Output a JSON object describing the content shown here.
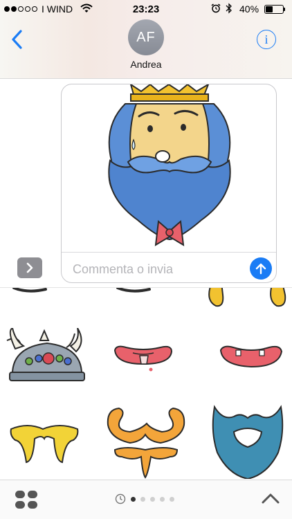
{
  "status_bar": {
    "signal": "●●○○○",
    "carrier": "I WIND",
    "time": "23:23",
    "battery_percent": "40%",
    "battery_level": 0.4,
    "icons": [
      "wifi-icon",
      "alarm-icon",
      "bluetooth-icon",
      "battery-icon"
    ]
  },
  "header": {
    "avatar_initials": "AF",
    "contact_name": "Andrea",
    "back_icon": "chevron-left-icon",
    "info_label": "i"
  },
  "compose": {
    "placeholder": "Commenta o invia",
    "value": "",
    "send_icon": "arrow-up-icon",
    "attached_sticker": "bearded-king-face-sticker"
  },
  "stickers": [
    "eyebrows-sticker",
    "golden-ears-sticker",
    "viking-helmet-sticker",
    "tongue-mouth-sticker",
    "open-mouth-sticker",
    "yellow-mustache-sticker",
    "orange-mustache-goatee-sticker",
    "blue-beard-sticker"
  ],
  "bottom_bar": {
    "pages": 5,
    "active_page": 1,
    "icons": [
      "app-drawer-icon",
      "recent-clock-icon",
      "chevron-up-icon"
    ]
  },
  "colors": {
    "accent": "#1a7cf5",
    "beard_blue": "#5b8fd6",
    "gold": "#f2c230",
    "lip_red": "#e8616b"
  }
}
